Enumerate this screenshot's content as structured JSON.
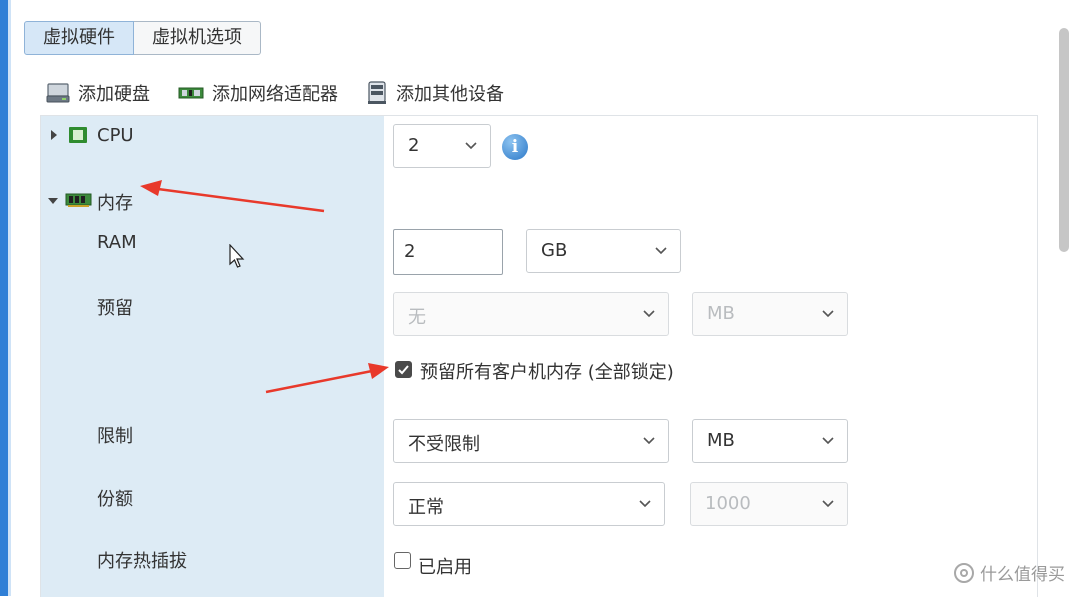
{
  "tabs": [
    {
      "label": "虚拟硬件",
      "active": true
    },
    {
      "label": "虚拟机选项",
      "active": false
    }
  ],
  "toolbar": {
    "add_disk": {
      "label": "添加硬盘",
      "icon": "hard-disk-icon"
    },
    "add_nic": {
      "label": "添加网络适配器",
      "icon": "network-adapter-icon"
    },
    "add_other": {
      "label": "添加其他设备",
      "icon": "other-device-icon"
    }
  },
  "cpu": {
    "label": "CPU",
    "value": "2",
    "icon": "cpu-chip-icon",
    "info_glyph": "i"
  },
  "memory": {
    "label": "内存",
    "icon": "memory-module-icon",
    "ram": {
      "label": "RAM",
      "value": "2",
      "unit": "GB"
    },
    "reservation": {
      "label": "预留",
      "value": "无",
      "unit": "MB",
      "lock_all_label": "预留所有客户机内存 (全部锁定)",
      "lock_all_checked": true
    },
    "limit": {
      "label": "限制",
      "value": "不受限制",
      "unit": "MB"
    },
    "shares": {
      "label": "份额",
      "value": "正常",
      "amount": "1000"
    },
    "hot_plug": {
      "label": "内存热插拔",
      "checkbox_label": "已启用",
      "checked": false
    }
  },
  "watermark": {
    "text": "什么值得买"
  },
  "colors": {
    "accent": "#2f7fd6",
    "label_bg": "#ddebf5",
    "annotation_arrow": "#e8392b"
  }
}
